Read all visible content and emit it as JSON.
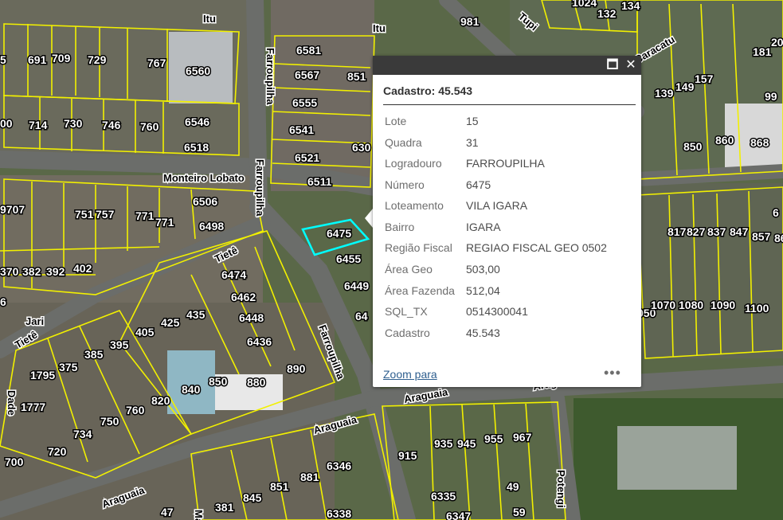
{
  "map": {
    "colors": {
      "parcel_outline": "#f2f000",
      "selection": "#00ffff",
      "ground": "#4a5a3a"
    },
    "street_labels": [
      "Itu",
      "Itu",
      "Tupi",
      "Farroupilha",
      "Farroupilha",
      "Farroupilha",
      "Monteiro Lobato",
      "Tietê",
      "Tietê",
      "Jari",
      "Araguaia",
      "Araguaia",
      "Araguaia",
      "Araguaia",
      "Potengi",
      "Caracatu",
      "Dade",
      "Ma"
    ],
    "lot_labels": [
      "1024",
      "132",
      "134",
      "981",
      "691",
      "709",
      "729",
      "767",
      "6560",
      "6581",
      "6567",
      "851",
      "6555",
      "6541",
      "6521",
      "6511",
      "630",
      "714",
      "730",
      "746",
      "760",
      "6546",
      "6518",
      "00",
      "139",
      "149",
      "157",
      "181",
      "20",
      "850",
      "860",
      "868",
      "9707",
      "751",
      "757",
      "771",
      "771",
      "6506",
      "6498",
      "6475",
      "6455",
      "6449",
      "64",
      "370",
      "382",
      "392",
      "402",
      "6474",
      "6462",
      "6448",
      "6436",
      "890",
      "405",
      "425",
      "435",
      "385",
      "395",
      "375",
      "1795",
      "1777",
      "820",
      "840",
      "850",
      "880",
      "760",
      "750",
      "734",
      "720",
      "700",
      "817",
      "827",
      "837",
      "847",
      "857",
      "86",
      "050",
      "1070",
      "1080",
      "1090",
      "1100",
      "915",
      "935",
      "945",
      "955",
      "967",
      "881",
      "851",
      "845",
      "381",
      "6346",
      "6335",
      "6338",
      "6347",
      "49",
      "59",
      "47",
      "99",
      "6",
      "5",
      "6"
    ],
    "selected_lot": "6475"
  },
  "popup": {
    "icons": {
      "maximize": "maximize-icon",
      "close": "close-icon",
      "more": "more-dots-icon"
    },
    "maximize_glyph": "🗖",
    "close_glyph": "✕",
    "title": "Cadastro: 45.543",
    "fields": [
      {
        "label": "Lote",
        "value": "15"
      },
      {
        "label": "Quadra",
        "value": "31"
      },
      {
        "label": "Logradouro",
        "value": "FARROUPILHA"
      },
      {
        "label": "Número",
        "value": "6475"
      },
      {
        "label": "Loteamento",
        "value": "VILA IGARA"
      },
      {
        "label": "Bairro",
        "value": "IGARA"
      },
      {
        "label": "Região Fiscal",
        "value": "REGIAO FISCAL GEO 0502"
      },
      {
        "label": "Área Geo",
        "value": "503,00"
      },
      {
        "label": "Área Fazenda",
        "value": "512,04"
      },
      {
        "label": "SQL_TX",
        "value": "0514300041"
      },
      {
        "label": "Cadastro",
        "value": "45.543"
      }
    ],
    "zoom_label": "Zoom para",
    "more_glyph": "•••"
  }
}
